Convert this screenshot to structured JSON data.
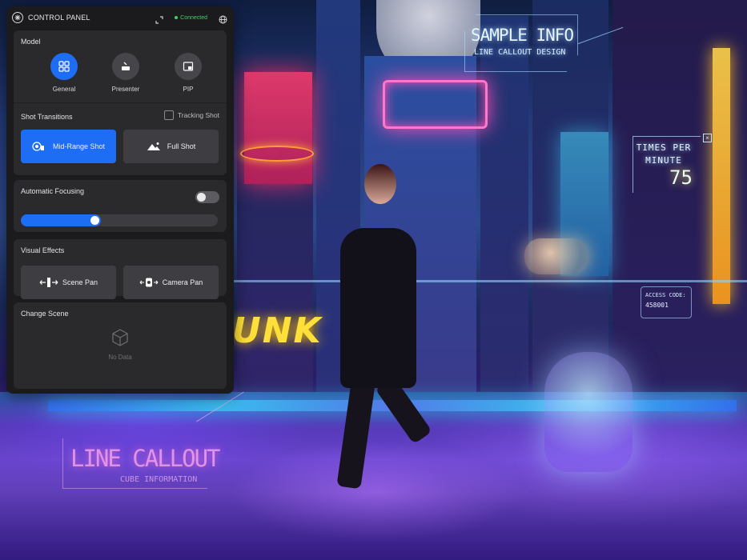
{
  "panel": {
    "title": "CONTROL PANEL",
    "status": "Connected"
  },
  "model": {
    "heading": "Model",
    "options": [
      {
        "label": "General",
        "icon": "grid-icon",
        "active": true
      },
      {
        "label": "Presenter",
        "icon": "podium-icon",
        "active": false
      },
      {
        "label": "PIP",
        "icon": "picture-in-picture-icon",
        "active": false
      }
    ]
  },
  "shot_transitions": {
    "heading": "Shot Transitions",
    "tracking_label": "Tracking Shot",
    "tracking_checked": false,
    "options": [
      {
        "label": "Mid-Range Shot",
        "icon": "mid-range-shot-icon",
        "active": true
      },
      {
        "label": "Full Shot",
        "icon": "mountain-icon",
        "active": false
      }
    ]
  },
  "focusing": {
    "heading": "Automatic Focusing",
    "enabled": false,
    "level": 0.38
  },
  "visual_effects": {
    "heading": "Visual Effects",
    "options": [
      {
        "label": "Scene Pan",
        "icon": "scene-pan-icon"
      },
      {
        "label": "Camera Pan",
        "icon": "camera-pan-icon"
      }
    ]
  },
  "change_scene": {
    "heading": "Change Scene",
    "empty_label": "No Data"
  },
  "overlays": {
    "sample_title": "SAMPLE INFO",
    "sample_sub": "LINE CALLOUT DESIGN",
    "times_label_1": "TIMES PER",
    "times_label_2": "MINUTE",
    "times_value": "75",
    "access_label": "ACCESS CODE:",
    "access_value": "458001",
    "callout_title": "LINE CALLOUT",
    "callout_sub": "CUBE INFORMATION",
    "graffiti": "UNK"
  },
  "colors": {
    "accent": "#1e6ef5",
    "status": "#3bd26b",
    "panel_bg": "#1b1b1d",
    "card_bg": "#2a2a2d"
  }
}
